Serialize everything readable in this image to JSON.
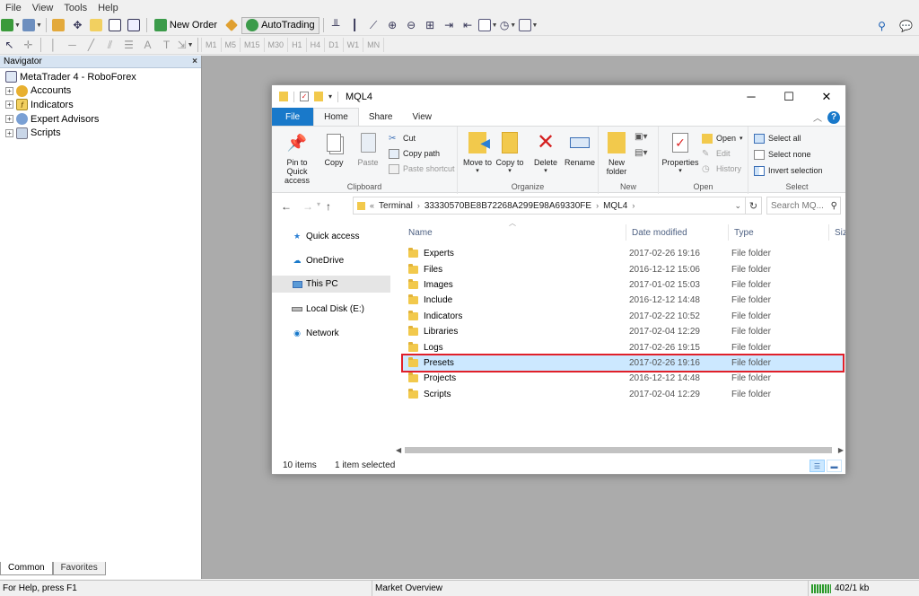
{
  "menu": [
    "File",
    "View",
    "Tools",
    "Help"
  ],
  "toolbar": {
    "new_order": "New Order",
    "autotrading": "AutoTrading",
    "timeframes": [
      "M1",
      "M5",
      "M15",
      "M30",
      "H1",
      "H4",
      "D1",
      "W1",
      "MN"
    ]
  },
  "navigator": {
    "title": "Navigator",
    "close": "×",
    "root": "MetaTrader 4 - RoboForex",
    "items": [
      "Accounts",
      "Indicators",
      "Expert Advisors",
      "Scripts"
    ],
    "tabs": [
      "Common",
      "Favorites"
    ],
    "active_tab": "Common"
  },
  "statusbar": {
    "help": "For Help, press F1",
    "profile": "Market Overview",
    "traffic": "402/1 kb"
  },
  "explorer": {
    "title": "MQL4",
    "ribbon_tabs": [
      "File",
      "Home",
      "Share",
      "View"
    ],
    "active_tab": "Home",
    "clipboard": {
      "label": "Clipboard",
      "pin": "Pin to Quick access",
      "copy": "Copy",
      "paste": "Paste",
      "cut": "Cut",
      "copy_path": "Copy path",
      "paste_shortcut": "Paste shortcut"
    },
    "organize": {
      "label": "Organize",
      "move_to": "Move to",
      "copy_to": "Copy to",
      "delete": "Delete",
      "rename": "Rename"
    },
    "new": {
      "label": "New",
      "new_folder": "New folder"
    },
    "open": {
      "label": "Open",
      "properties": "Properties",
      "open": "Open",
      "edit": "Edit",
      "history": "History"
    },
    "select": {
      "label": "Select",
      "select_all": "Select all",
      "select_none": "Select none",
      "invert": "Invert selection"
    },
    "address": {
      "parts": [
        "Terminal",
        "33330570BE8B72268A299E98A69330FE",
        "MQL4"
      ],
      "search_placeholder": "Search MQ..."
    },
    "nav_pane": [
      "Quick access",
      "OneDrive",
      "This PC",
      "Local Disk (E:)",
      "Network"
    ],
    "nav_selected": "This PC",
    "columns": [
      "Name",
      "Date modified",
      "Type",
      "Size"
    ],
    "files": [
      {
        "name": "Experts",
        "date": "2017-02-26 19:16",
        "type": "File folder"
      },
      {
        "name": "Files",
        "date": "2016-12-12 15:06",
        "type": "File folder"
      },
      {
        "name": "Images",
        "date": "2017-01-02 15:03",
        "type": "File folder"
      },
      {
        "name": "Include",
        "date": "2016-12-12 14:48",
        "type": "File folder"
      },
      {
        "name": "Indicators",
        "date": "2017-02-22 10:52",
        "type": "File folder"
      },
      {
        "name": "Libraries",
        "date": "2017-02-04 12:29",
        "type": "File folder"
      },
      {
        "name": "Logs",
        "date": "2017-02-26 19:15",
        "type": "File folder"
      },
      {
        "name": "Presets",
        "date": "2017-02-26 19:16",
        "type": "File folder"
      },
      {
        "name": "Projects",
        "date": "2016-12-12 14:48",
        "type": "File folder"
      },
      {
        "name": "Scripts",
        "date": "2017-02-04 12:29",
        "type": "File folder"
      }
    ],
    "selected_file": "Presets",
    "status_count": "10 items",
    "status_selected": "1 item selected"
  },
  "colors": {
    "file_tab": "#1979ca",
    "selection": "#cce8ff",
    "highlight_border": "#e0202a",
    "folder": "#f2c94c"
  }
}
